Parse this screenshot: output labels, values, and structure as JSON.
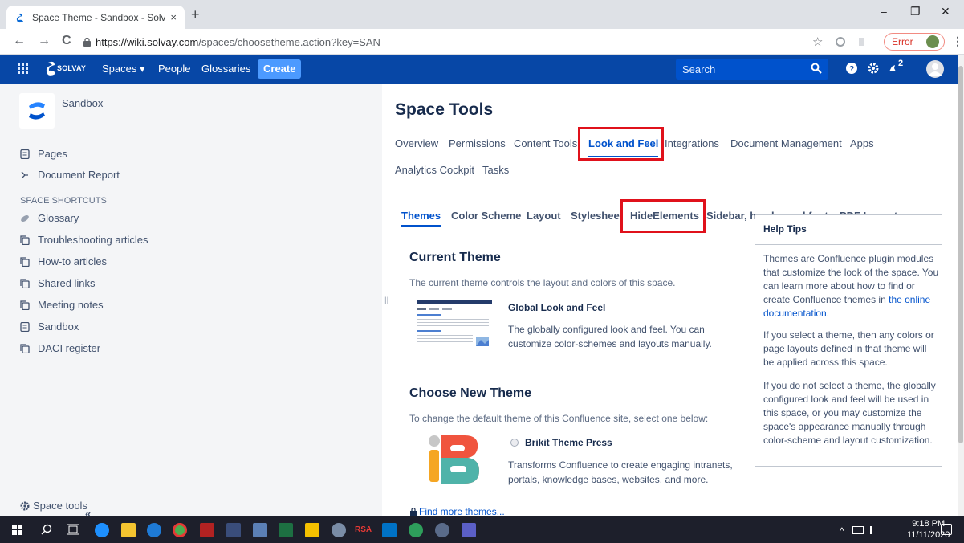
{
  "browser": {
    "tab_title": "Space Theme - Sandbox - Solvay",
    "tab_close": "×",
    "new_tab": "+",
    "url_host": "https://wiki.solvay.com",
    "url_path": "/spaces/choosetheme.action?key=SAN",
    "error_label": "Error",
    "back": "←",
    "forward": "→",
    "reload": "C",
    "star": "☆",
    "menu": "⋮",
    "minimize": "–",
    "restore": "❐",
    "close": "✕"
  },
  "header": {
    "brand": "SOLVAY",
    "nav": [
      "Spaces ▾",
      "People",
      "Glossaries"
    ],
    "create": "Create",
    "search_placeholder": "Search",
    "notifications_badge": "2",
    "colors": {
      "bar": "#0747a6",
      "create": "#4c9aff"
    }
  },
  "sidebar": {
    "space_name": "Sandbox",
    "items": [
      {
        "label": "Pages",
        "icon": "page-icon"
      },
      {
        "label": "Document Report",
        "icon": "report-icon"
      }
    ],
    "shortcuts_heading": "SPACE SHORTCUTS",
    "shortcuts": [
      {
        "label": "Glossary",
        "icon": "link-icon"
      },
      {
        "label": "Troubleshooting articles",
        "icon": "page-tree-icon"
      },
      {
        "label": "How-to articles",
        "icon": "page-tree-icon"
      },
      {
        "label": "Shared links",
        "icon": "page-tree-icon"
      },
      {
        "label": "Meeting notes",
        "icon": "page-tree-icon"
      },
      {
        "label": "Sandbox",
        "icon": "page-icon"
      },
      {
        "label": "DACI register",
        "icon": "page-tree-icon"
      }
    ],
    "space_tools": "Space tools",
    "collapse": "«"
  },
  "main": {
    "title": "Space Tools",
    "tabs": [
      "Overview",
      "Permissions",
      "Content Tools",
      "Look and Feel",
      "Integrations",
      "Document Management",
      "Apps",
      "Analytics Cockpit",
      "Tasks"
    ],
    "active_tab": "Look and Feel",
    "subtabs": [
      "Themes",
      "Color Scheme",
      "Layout",
      "Stylesheet",
      "HideElements",
      "Sidebar, header and footer",
      "PDF Layout",
      "..."
    ],
    "active_subtab": "Themes",
    "current_theme": {
      "heading": "Current Theme",
      "description": "The current theme controls the layout and colors of this space.",
      "name": "Global Look and Feel",
      "text": "The globally configured look and feel. You can customize color-schemes and layouts manually."
    },
    "choose_theme": {
      "heading": "Choose New Theme",
      "description": "To change the default theme of this Confluence site, select one below:",
      "name": "Brikit Theme Press",
      "text": "Transforms Confluence to create engaging intranets, portals, knowledge bases, websites, and more."
    },
    "find_more": "Find more themes..."
  },
  "help_tips": {
    "title": "Help Tips",
    "p1": "Themes are Confluence plugin modules that customize the look of the space. You can learn more about how to find or create Confluence themes in",
    "p1_link": "the online documentation",
    "p1_end": ".",
    "p2": "If you select a theme, then any colors or page layouts defined in that theme will be applied across this space.",
    "p3": "If you do not select a theme, the globally configured look and feel will be used in this space, or you may customize the space's appearance manually through color-scheme and layout customization."
  },
  "taskbar": {
    "time": "9:18 PM",
    "date": "11/11/2020",
    "rsa_label": "RSA"
  }
}
